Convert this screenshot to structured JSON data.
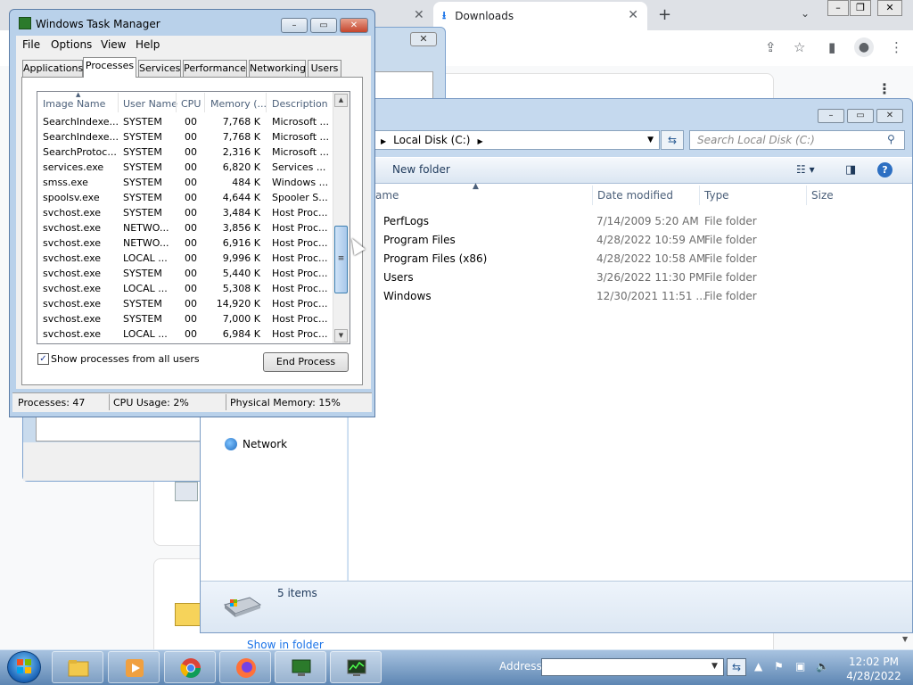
{
  "chrome": {
    "tab_title": "Downloads",
    "show_in_folder": "Show in folder"
  },
  "explorer": {
    "breadcrumb": "Local Disk (C:)",
    "search_placeholder": "Search Local Disk (C:)",
    "new_folder": "New folder",
    "columns": [
      "ame",
      "Date modified",
      "Type",
      "Size"
    ],
    "rows": [
      {
        "name": "PerfLogs",
        "date": "7/14/2009 5:20 AM",
        "type": "File folder"
      },
      {
        "name": "Program Files",
        "date": "4/28/2022 10:59 AM",
        "type": "File folder"
      },
      {
        "name": "Program Files (x86)",
        "date": "4/28/2022 10:58 AM",
        "type": "File folder"
      },
      {
        "name": "Users",
        "date": "3/26/2022 11:30 PM",
        "type": "File folder"
      },
      {
        "name": "Windows",
        "date": "12/30/2021 11:51 ...",
        "type": "File folder"
      }
    ],
    "nav_network": "Network",
    "item_count": "5 items"
  },
  "taskmgr": {
    "title": "Windows Task Manager",
    "menu": [
      "File",
      "Options",
      "View",
      "Help"
    ],
    "tabs": [
      "Applications",
      "Processes",
      "Services",
      "Performance",
      "Networking",
      "Users"
    ],
    "active_tab": "Processes",
    "columns": [
      "Image Name",
      "User Name",
      "CPU",
      "Memory (...",
      "Description"
    ],
    "processes": [
      {
        "image": "SearchIndexe...",
        "user": "SYSTEM",
        "cpu": "00",
        "mem": "7,768 K",
        "desc": "Microsoft ..."
      },
      {
        "image": "SearchIndexe...",
        "user": "SYSTEM",
        "cpu": "00",
        "mem": "7,768 K",
        "desc": "Microsoft ..."
      },
      {
        "image": "SearchProtoc...",
        "user": "SYSTEM",
        "cpu": "00",
        "mem": "2,316 K",
        "desc": "Microsoft ..."
      },
      {
        "image": "services.exe",
        "user": "SYSTEM",
        "cpu": "00",
        "mem": "6,820 K",
        "desc": "Services ..."
      },
      {
        "image": "smss.exe",
        "user": "SYSTEM",
        "cpu": "00",
        "mem": "484 K",
        "desc": "Windows ..."
      },
      {
        "image": "spoolsv.exe",
        "user": "SYSTEM",
        "cpu": "00",
        "mem": "4,644 K",
        "desc": "Spooler S..."
      },
      {
        "image": "svchost.exe",
        "user": "SYSTEM",
        "cpu": "00",
        "mem": "3,484 K",
        "desc": "Host Proc..."
      },
      {
        "image": "svchost.exe",
        "user": "NETWO...",
        "cpu": "00",
        "mem": "3,856 K",
        "desc": "Host Proc..."
      },
      {
        "image": "svchost.exe",
        "user": "NETWO...",
        "cpu": "00",
        "mem": "6,916 K",
        "desc": "Host Proc..."
      },
      {
        "image": "svchost.exe",
        "user": "LOCAL ...",
        "cpu": "00",
        "mem": "9,996 K",
        "desc": "Host Proc..."
      },
      {
        "image": "svchost.exe",
        "user": "SYSTEM",
        "cpu": "00",
        "mem": "5,440 K",
        "desc": "Host Proc..."
      },
      {
        "image": "svchost.exe",
        "user": "LOCAL ...",
        "cpu": "00",
        "mem": "5,308 K",
        "desc": "Host Proc..."
      },
      {
        "image": "svchost.exe",
        "user": "SYSTEM",
        "cpu": "00",
        "mem": "14,920 K",
        "desc": "Host Proc..."
      },
      {
        "image": "svchost.exe",
        "user": "SYSTEM",
        "cpu": "00",
        "mem": "7,000 K",
        "desc": "Host Proc..."
      },
      {
        "image": "svchost.exe",
        "user": "LOCAL ...",
        "cpu": "00",
        "mem": "6,984 K",
        "desc": "Host Proc..."
      }
    ],
    "show_all_users": "Show processes from all users",
    "show_all_users_checked": true,
    "end_process": "End Process",
    "status": {
      "processes": "Processes: 47",
      "cpu": "CPU Usage: 2%",
      "memory": "Physical Memory: 15%"
    }
  },
  "taskbar": {
    "address_label": "Address",
    "address_value": "",
    "time": "12:02 PM",
    "date": "4/28/2022"
  },
  "colors": {
    "taskbar_top": "#a8c3e0",
    "taskbar_bottom": "#5d86b3",
    "window_frame": "#b9d1ea",
    "link": "#1a73e8"
  }
}
